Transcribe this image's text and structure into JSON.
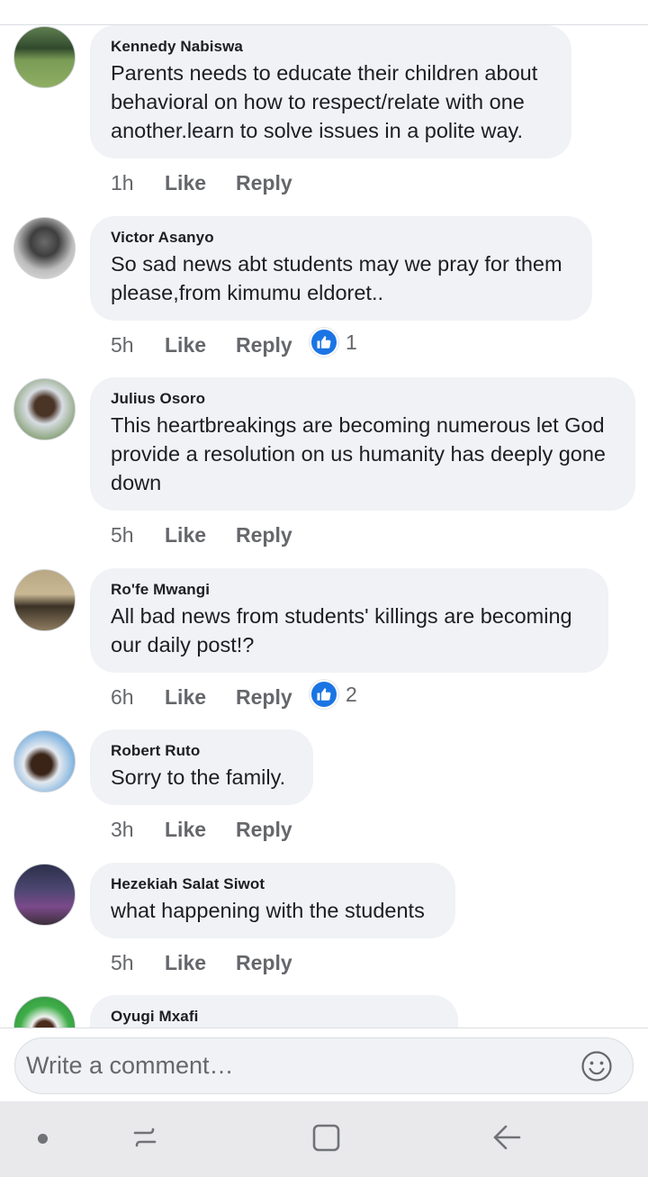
{
  "comments": [
    {
      "author": "Kennedy Nabiswa",
      "text": "Parents needs to educate their children about\nbehavioral on how to respect/relate with one\nanother.learn to solve issues in a polite way.",
      "time": "1h",
      "like_label": "Like",
      "reply_label": "Reply"
    },
    {
      "author": "Victor Asanyo",
      "text": "So sad news abt students may we pray for them\nplease,from kimumu eldoret..",
      "time": "5h",
      "like_label": "Like",
      "reply_label": "Reply",
      "reaction_count": "1"
    },
    {
      "author": "Julius Osoro",
      "text": "This heartbreakings are becoming numerous let God\nprovide a resolution on us humanity has deeply gone\ndown",
      "time": "5h",
      "like_label": "Like",
      "reply_label": "Reply"
    },
    {
      "author": "Ro'fe Mwangi",
      "text": "All bad news from students' killings are becoming\nour daily post!?",
      "time": "6h",
      "like_label": "Like",
      "reply_label": "Reply",
      "reaction_count": "2"
    },
    {
      "author": "Robert Ruto",
      "text": "Sorry to the family.",
      "time": "3h",
      "like_label": "Like",
      "reply_label": "Reply"
    },
    {
      "author": "Hezekiah Salat Siwot",
      "text": "what happening with the students",
      "time": "5h",
      "like_label": "Like",
      "reply_label": "Reply"
    },
    {
      "author": "Oyugi Mxafi"
    }
  ],
  "composer": {
    "placeholder": "Write a comment…",
    "emoji_icon": "smiley-icon"
  },
  "reaction_icon": "thumbs-up-icon",
  "nav": {
    "icons": [
      "dot-icon",
      "recent-apps-icon",
      "home-icon",
      "back-icon"
    ]
  },
  "colors": {
    "bubble": "#f0f2f5",
    "accent": "#1b74e4",
    "meta": "#65676b"
  }
}
